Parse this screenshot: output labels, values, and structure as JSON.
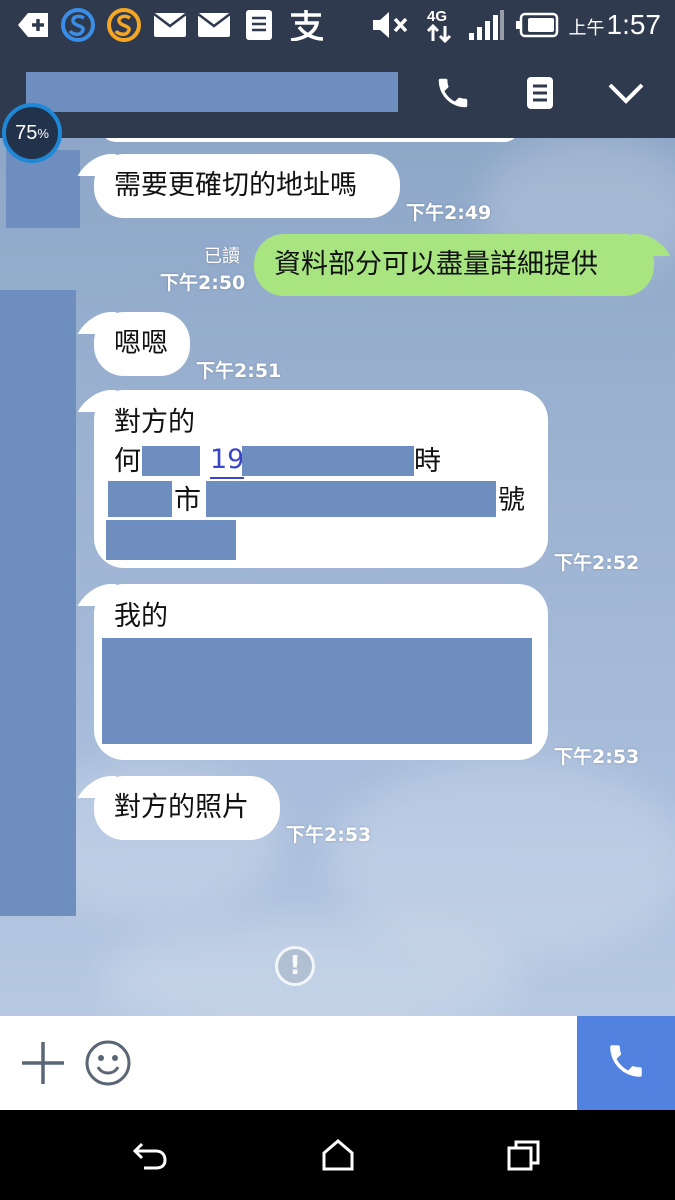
{
  "status_bar": {
    "ampm": "上午",
    "time": "1:57",
    "network": "4G",
    "icons": [
      "notification-plus-icon",
      "sogou-icon",
      "sogou-orange-icon",
      "mail-icon",
      "mail-icon",
      "document-icon",
      "alipay-icon",
      "mute-icon",
      "network-4g-icon",
      "signal-icon",
      "battery-icon"
    ]
  },
  "header": {
    "icons": [
      "phone-icon",
      "notes-icon",
      "chevron-down-icon"
    ]
  },
  "battery_widget": {
    "percent": "75",
    "unit": "%"
  },
  "messages": [
    {
      "side": "left",
      "lines": [
        "需要更確切的地址嗎"
      ],
      "time": "下午2:49"
    },
    {
      "side": "right",
      "lines": [
        "資料部分可以盡量詳細提供"
      ],
      "read": "已讀",
      "time": "下午2:50"
    },
    {
      "side": "left",
      "lines": [
        "嗯嗯"
      ],
      "time": "下午2:51"
    },
    {
      "side": "left",
      "lines": [
        "對方的",
        "何",
        "19",
        "時",
        "市",
        "號"
      ],
      "time": "下午2:52"
    },
    {
      "side": "left",
      "lines": [
        "我的"
      ],
      "time": "下午2:53"
    },
    {
      "side": "left",
      "lines": [
        "對方的照片"
      ],
      "time": "下午2:53"
    }
  ],
  "input_bar": {
    "icons": [
      "plus-icon",
      "emoji-icon",
      "call-icon"
    ]
  },
  "nav_bar": {
    "icons": [
      "back-icon",
      "home-icon",
      "recent-apps-icon"
    ]
  },
  "colors": {
    "header": "#2f3a4e",
    "accent": "#5282e0",
    "my_bubble": "#a8e480",
    "redaction": "#6d8ebf"
  }
}
